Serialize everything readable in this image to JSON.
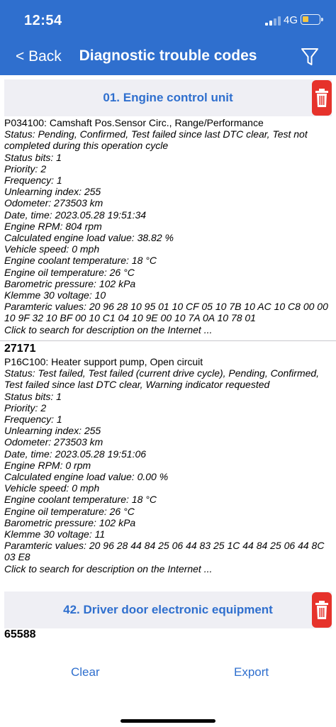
{
  "status_bar": {
    "time": "12:54",
    "network": "4G"
  },
  "nav": {
    "back_label": "< Back",
    "title": "Diagnostic trouble codes"
  },
  "sections": [
    {
      "title": "01. Engine control unit"
    },
    {
      "title": "42. Driver door electronic equipment"
    }
  ],
  "entries": [
    {
      "code_line": "P034100: Camshaft Pos.Sensor Circ., Range/Performance",
      "status": "Status: Pending, Confirmed, Test failed since last DTC clear, Test not completed during this operation cycle",
      "details": [
        "Status bits: 1",
        "Priority: 2",
        "Frequency: 1",
        "Unlearning index: 255",
        "Odometer: 273503 km",
        "Date, time: 2023.05.28 19:51:34",
        "Engine RPM: 804 rpm",
        "Calculated engine load value: 38.82 %",
        "Vehicle speed: 0 mph",
        "Engine coolant temperature: 18 °C",
        "Engine oil temperature: 26 °C",
        "Barometric pressure: 102 kPa",
        "Klemme 30 voltage: 10"
      ],
      "parametric": "Paramteric values:  20 96 28 10 95 01 10 CF 05 10 7B 10 AC 10 C8 00 00 10 9F 32 10 BF 00 10 C1 04 10 9E 00 10 7A 0A 10 78 01",
      "link": "Click to search for description on the Internet ..."
    },
    {
      "group_code": "27171",
      "code_line": "P16C100: Heater support pump, Open circuit",
      "status": "Status: Test failed, Test failed (current drive cycle), Pending, Confirmed, Test failed since last DTC clear, Warning indicator requested",
      "details": [
        "Status bits: 1",
        "Priority: 2",
        "Frequency: 1",
        "Unlearning index: 255",
        "Odometer: 273503 km",
        "Date, time: 2023.05.28 19:51:06",
        "Engine RPM: 0 rpm",
        "Calculated engine load value: 0.00 %",
        "Vehicle speed: 0 mph",
        "Engine coolant temperature: 18 °C",
        "Engine oil temperature: 26 °C",
        "Barometric pressure: 102 kPa",
        "Klemme 30 voltage: 11"
      ],
      "parametric": "Paramteric values:  20 96 28 44 84 25 06 44 83 25 1C 44 84 25 06 44 8C 03 E8",
      "link": "Click to search for description on the Internet ..."
    }
  ],
  "section2_group_code": "65588",
  "bottom_bar": {
    "clear_label": "Clear",
    "export_label": "Export"
  },
  "colors": {
    "accent": "#2f6fce",
    "delete": "#e6322b",
    "section_bg": "#efeff4"
  }
}
